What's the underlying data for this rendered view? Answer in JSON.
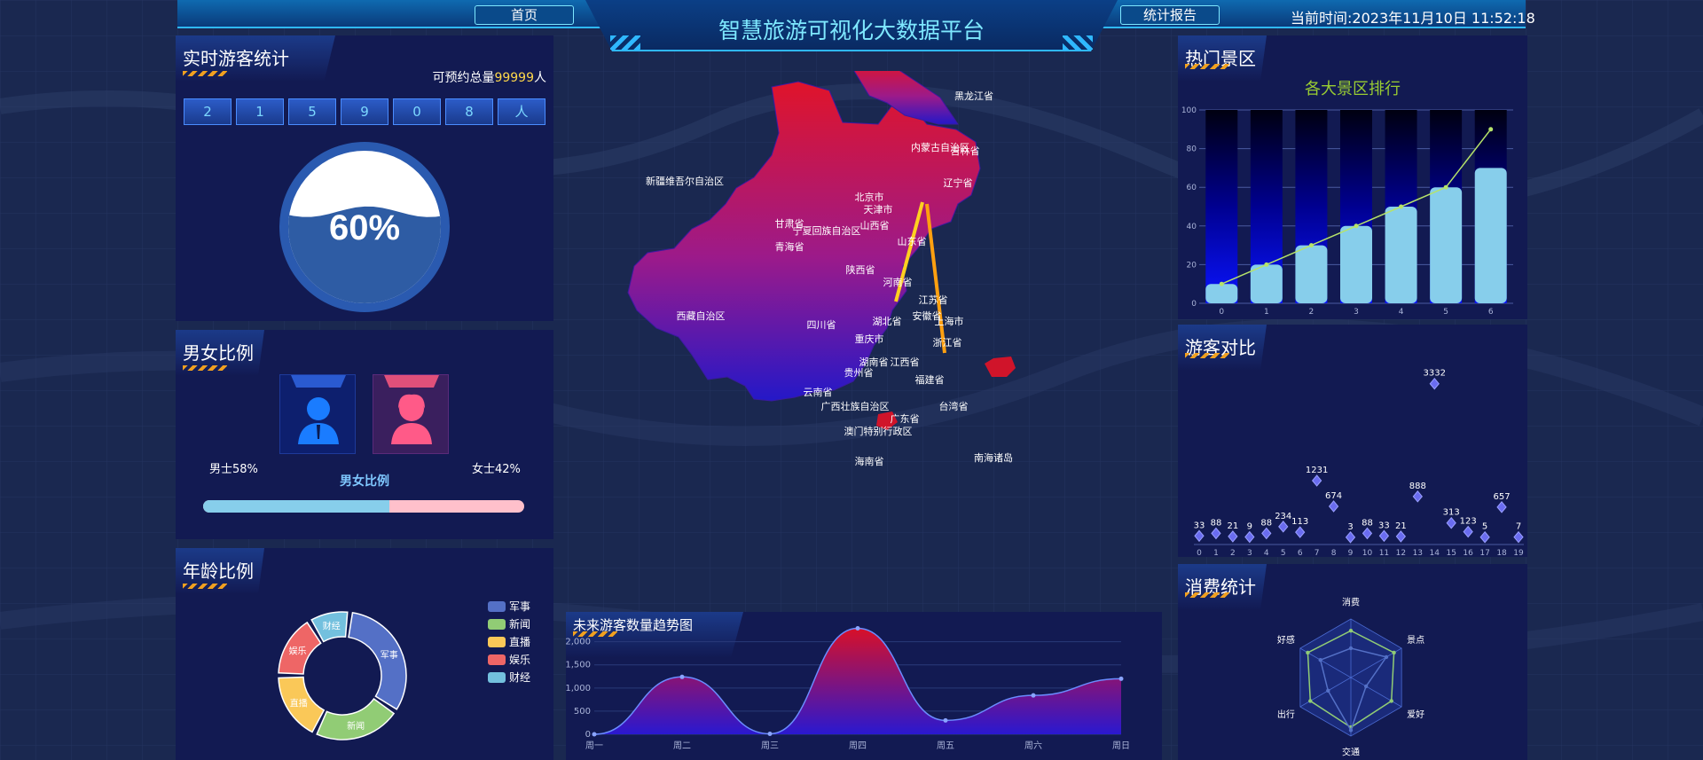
{
  "header": {
    "title": "智慧旅游可视化大数据平台",
    "nav_home": "首页",
    "nav_report": "统计报告",
    "time_label": "当前时间:",
    "time_value": "2023年11月10日 11:52:18"
  },
  "visitors": {
    "title": "实时游客统计",
    "reserve_label": "可预约总量",
    "reserve_value": "99999",
    "reserve_unit": "人",
    "digits": [
      "2",
      "1",
      "5",
      "9",
      "0",
      "8",
      "人"
    ],
    "gauge_text": "60%",
    "gauge_fraction": 0.6
  },
  "gender": {
    "title": "男女比例",
    "male_label": "男士58%",
    "female_label": "女士42%",
    "bar_label": "男女比例",
    "male_fraction": 0.58
  },
  "age": {
    "title": "年龄比例",
    "chart_data": {
      "type": "pie",
      "categories": [
        "军事",
        "新闻",
        "直播",
        "娱乐",
        "财经"
      ],
      "values": [
        40,
        28,
        22,
        20,
        13
      ],
      "colors": [
        "#5470c6",
        "#91cc75",
        "#fac858",
        "#ee6666",
        "#73c0de"
      ],
      "legend": "right"
    }
  },
  "map": {
    "labels": [
      "黑龙江省",
      "吉林省",
      "辽宁省",
      "内蒙古自治区",
      "新疆维吾尔自治区",
      "甘肃省",
      "宁夏回族自治区",
      "山西省",
      "北京市",
      "天津市",
      "山东省",
      "青海省",
      "陕西省",
      "河南省",
      "江苏省",
      "西藏自治区",
      "四川省",
      "湖北省",
      "安徽省",
      "上海市",
      "重庆市",
      "浙江省",
      "湖南省",
      "江西省",
      "贵州省",
      "福建省",
      "云南省",
      "广西壮族自治区",
      "广东省",
      "台湾省",
      "澳门特别行政区",
      "海南省",
      "南海诸岛"
    ]
  },
  "trend": {
    "title": "未来游客数量趋势图",
    "chart_data": {
      "type": "area",
      "categories": [
        "周一",
        "周二",
        "周三",
        "周四",
        "周五",
        "周六",
        "周日"
      ],
      "values": [
        0,
        1240,
        10,
        2290,
        300,
        840,
        1200
      ],
      "yticks": [
        "0",
        "500",
        "1,000",
        "1,500",
        "2,000"
      ],
      "ylim": [
        0,
        2300
      ]
    }
  },
  "hot": {
    "title": "热门景区",
    "chart_title": "各大景区排行",
    "chart_data": {
      "type": "bar",
      "categories": [
        "0",
        "1",
        "2",
        "3",
        "4",
        "5",
        "6"
      ],
      "values": [
        10,
        20,
        30,
        40,
        50,
        60,
        70
      ],
      "line_values": [
        10,
        20,
        30,
        40,
        50,
        60,
        90
      ],
      "yticks": [
        "0",
        "20",
        "40",
        "60",
        "80",
        "100"
      ],
      "ylim": [
        0,
        100
      ],
      "grid": true
    }
  },
  "compare": {
    "title": "游客对比",
    "chart_data": {
      "type": "scatter",
      "x": [
        "0",
        "1",
        "2",
        "3",
        "4",
        "5",
        "6",
        "7",
        "8",
        "9",
        "10",
        "11",
        "12",
        "13",
        "14",
        "15",
        "16",
        "17",
        "18",
        "19"
      ],
      "values": [
        33,
        88,
        21,
        9,
        88,
        234,
        113,
        1231,
        674,
        3,
        88,
        33,
        21,
        888,
        3332,
        313,
        123,
        5,
        657,
        7
      ],
      "ylim": [
        0,
        3500
      ]
    }
  },
  "consume": {
    "title": "消费统计",
    "chart_data": {
      "type": "radar",
      "axes": [
        "消费",
        "景点",
        "爱好",
        "交通",
        "出行",
        "好感"
      ],
      "series_a": [
        0.8,
        0.85,
        0.8,
        0.85,
        0.8,
        0.85
      ],
      "series_b": [
        0.5,
        0.7,
        0.3,
        0.9,
        0.45,
        0.6
      ]
    }
  }
}
